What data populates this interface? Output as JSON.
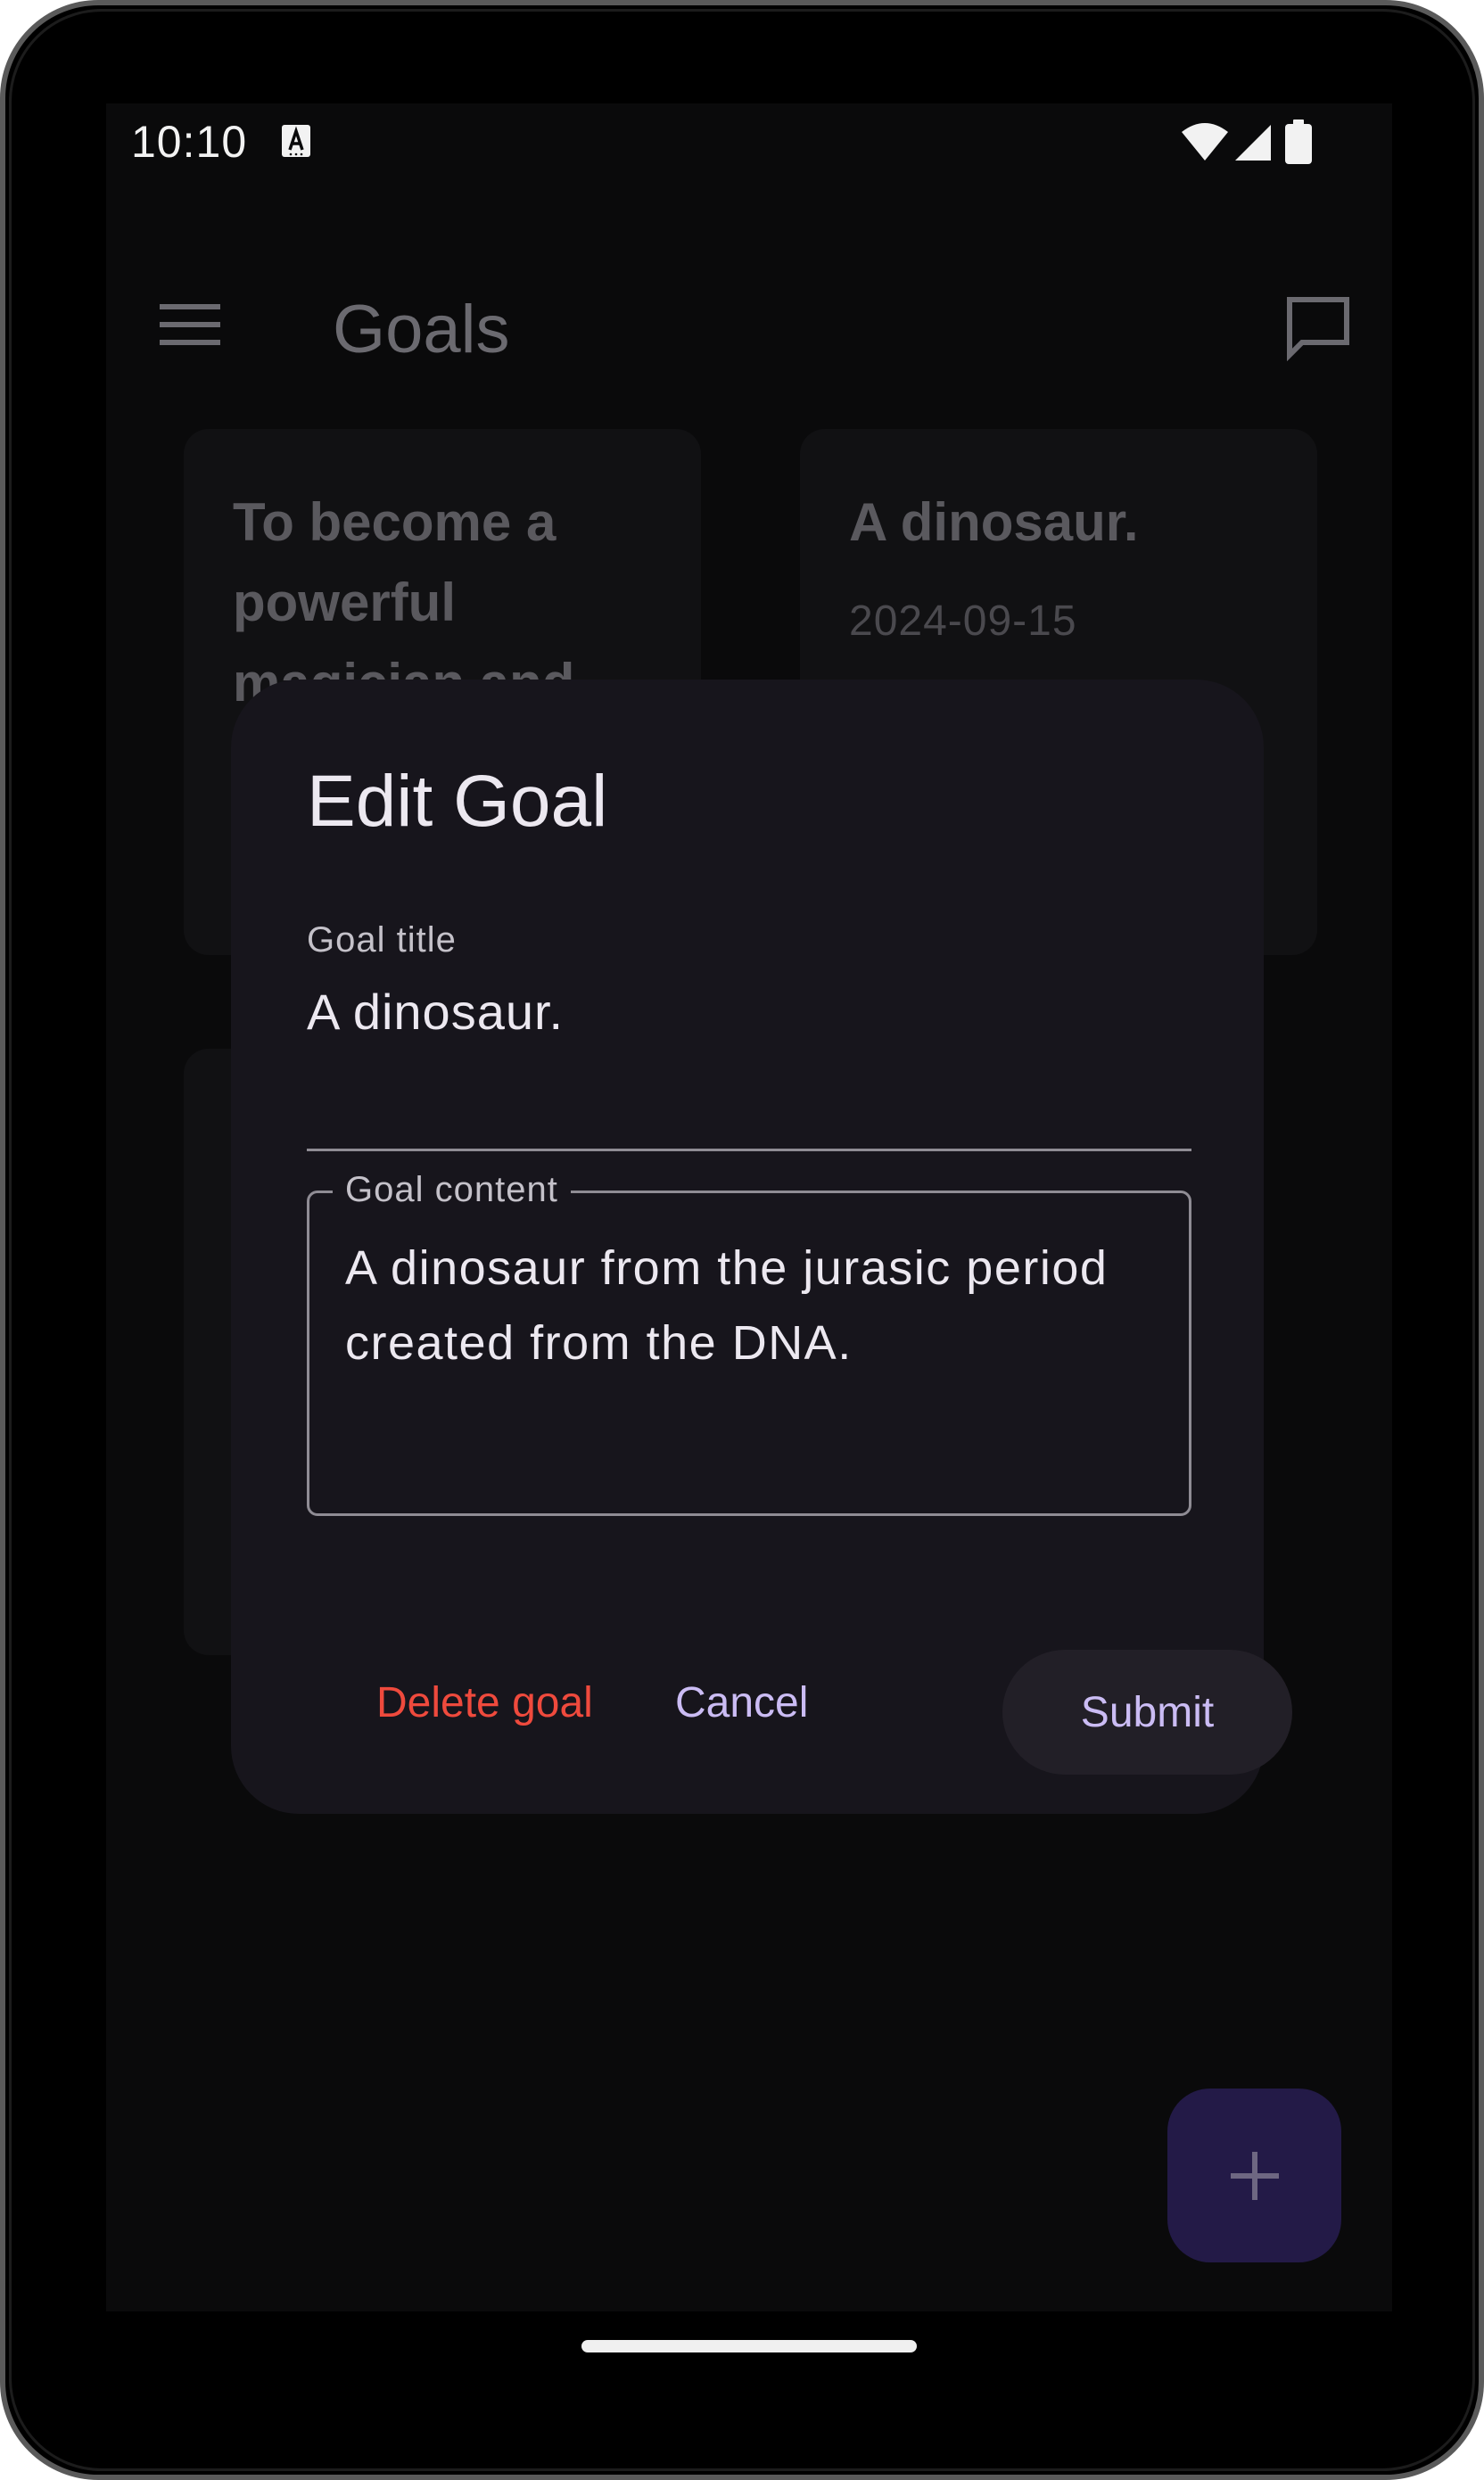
{
  "status_bar": {
    "time": "10:10",
    "icons": [
      "accessibility-a-icon",
      "wifi-icon",
      "signal-icon",
      "battery-icon"
    ]
  },
  "app_bar": {
    "title": "Goals",
    "left_icon": "menu-icon",
    "right_icon": "chat-icon"
  },
  "cards": [
    {
      "title": "To become a powerful magician and",
      "date": ""
    },
    {
      "title": "A dinosaur.",
      "date": "2024-09-15"
    }
  ],
  "dialog": {
    "title": "Edit Goal",
    "title_field": {
      "label": "Goal title",
      "value": "A dinosaur."
    },
    "content_field": {
      "label": "Goal content",
      "value": "A dinosaur from the jurasic period created from the DNA."
    },
    "actions": {
      "delete": "Delete goal",
      "cancel": "Cancel",
      "submit": "Submit"
    }
  },
  "fab": {
    "icon": "plus-icon"
  },
  "colors": {
    "background": "#0a0a0b",
    "dialog": "#17151c",
    "accent": "#cbbcf4",
    "danger": "#ef4a3d",
    "fab": "#231a47"
  }
}
